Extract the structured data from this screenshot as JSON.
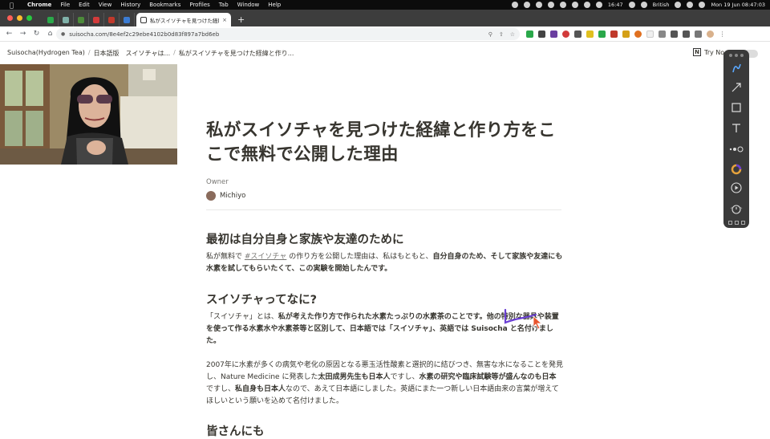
{
  "menubar": {
    "app": "Chrome",
    "items": [
      "File",
      "Edit",
      "View",
      "History",
      "Bookmarks",
      "Profiles",
      "Tab",
      "Window",
      "Help"
    ],
    "clock_small": "16:47",
    "input_source": "British",
    "datetime": "Mon 19 Jun  08:47:03"
  },
  "tab": {
    "title": "私がスイソチャを見つけた経緯と作り方",
    "close": "×",
    "new_tab": "+"
  },
  "address": {
    "url": "suisocha.com/8e4ef2c29ebe4102b0d83f897a7bd6eb"
  },
  "notion": {
    "breadcrumbs": [
      "Suisocha(Hydrogen Tea)",
      "日本語版　スイソチャは...",
      "私がスイソチャを見つけた経緯と作り..."
    ],
    "try_notion": "Try No"
  },
  "article": {
    "title": "私がスイソチャを見つけた経緯と作り方をここで無料で公開した理由",
    "owner_label": "Owner",
    "owner_name": "Michiyo",
    "h1": "最初は自分自身と家族や友達のために",
    "p1_a": "私が無料で ",
    "p1_tag": "#スイソチャ",
    "p1_b": " の作り方を公開した理由は、私はもともと、",
    "p1_c": "自分自身のため、そして家族や友達にも水素を試してもらいたくて、この実験を開始したんです。",
    "h2": "スイソチャってなに?",
    "p2_a": "「スイソチャ」とは、",
    "p2_b": "私が考えた作り方で作られた水素たっぷりの水素茶のことです。",
    "p2_c": "他の特別な器具や装置を使って作る水素水や水素茶等と区別して、日本語では「スイソチャ」、英語では ",
    "p2_d": "Suisocha",
    "p2_e": " と名付けました。",
    "p3_a": "2007年に水素が多くの病気や老化の原因となる悪玉活性酸素と選択的に結びつき、無害な水になることを発見し、Nature Medicine に発表した",
    "p3_b": "太田成男先生も日本人",
    "p3_c": "ですし、",
    "p3_d": "水素の研究や臨床試験等が盛んなのも日本",
    "p3_e": "ですし、",
    "p3_f": "私自身も日本人",
    "p3_g": "なので、あえて日本語にしました。英語にまた一つ新しい日本語由来の言葉が増えてほしいという願いを込めて名付けました。",
    "h3": "皆さんにも"
  },
  "colors": {
    "menubar_bg": "#0c0c0c",
    "tabbar_bg": "#3d3d3d",
    "text": "#37352f",
    "annot_panel": "#3a3a3a",
    "scribble": "#6a3fd4"
  }
}
